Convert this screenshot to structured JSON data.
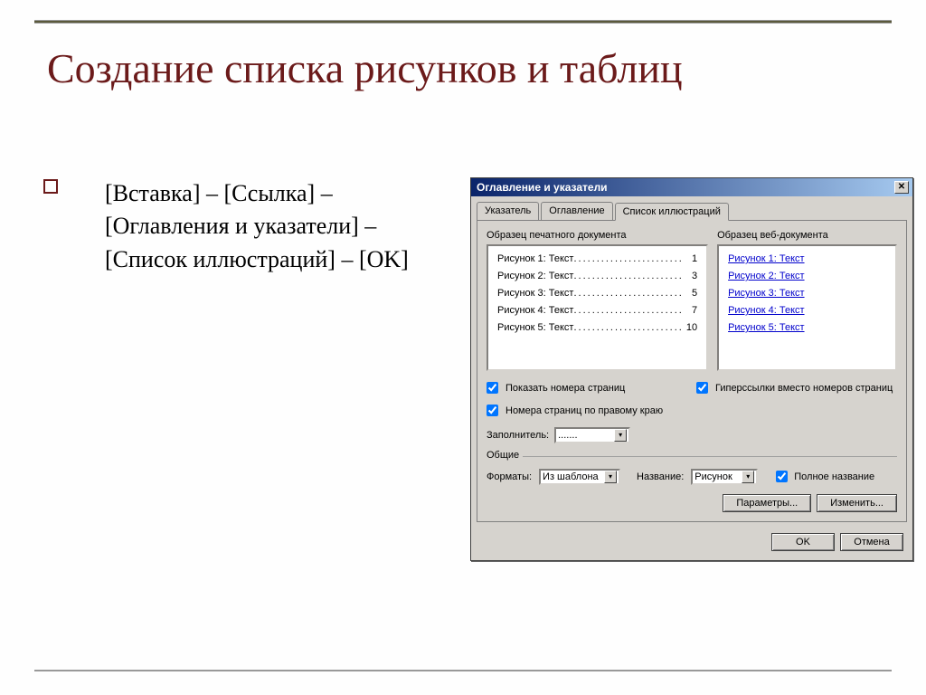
{
  "title": "Создание списка рисунков и таблиц",
  "body_text": "[Вставка] – [Ссылка] – [Оглавления и указатели] – [Список иллюстраций] – [OK]",
  "dialog": {
    "title": "Оглавление и указатели",
    "tabs": [
      "Указатель",
      "Оглавление",
      "Список иллюстраций"
    ],
    "print_preview_label": "Образец печатного документа",
    "web_preview_label": "Образец веб-документа",
    "toc_items": [
      {
        "label": "Рисунок 1: Текст",
        "page": "1"
      },
      {
        "label": "Рисунок 2: Текст",
        "page": "3"
      },
      {
        "label": "Рисунок 3: Текст",
        "page": "5"
      },
      {
        "label": "Рисунок 4: Текст",
        "page": "7"
      },
      {
        "label": "Рисунок 5: Текст",
        "page": "10"
      }
    ],
    "web_items": [
      "Рисунок 1: Текст",
      "Рисунок 2: Текст",
      "Рисунок 3: Текст",
      "Рисунок 4: Текст",
      "Рисунок 5: Текст"
    ],
    "show_pages_label": "Показать номера страниц",
    "right_align_label": "Номера страниц по правому краю",
    "hyperlinks_label": "Гиперссылки вместо номеров страниц",
    "leader_label": "Заполнитель:",
    "leader_value": ".......",
    "group_label": "Общие",
    "formats_label": "Форматы:",
    "formats_value": "Из шаблона",
    "caption_label": "Название:",
    "caption_value": "Рисунок",
    "full_caption_label": "Полное название",
    "params_btn": "Параметры...",
    "modify_btn": "Изменить...",
    "ok_btn": "OK",
    "cancel_btn": "Отмена"
  }
}
